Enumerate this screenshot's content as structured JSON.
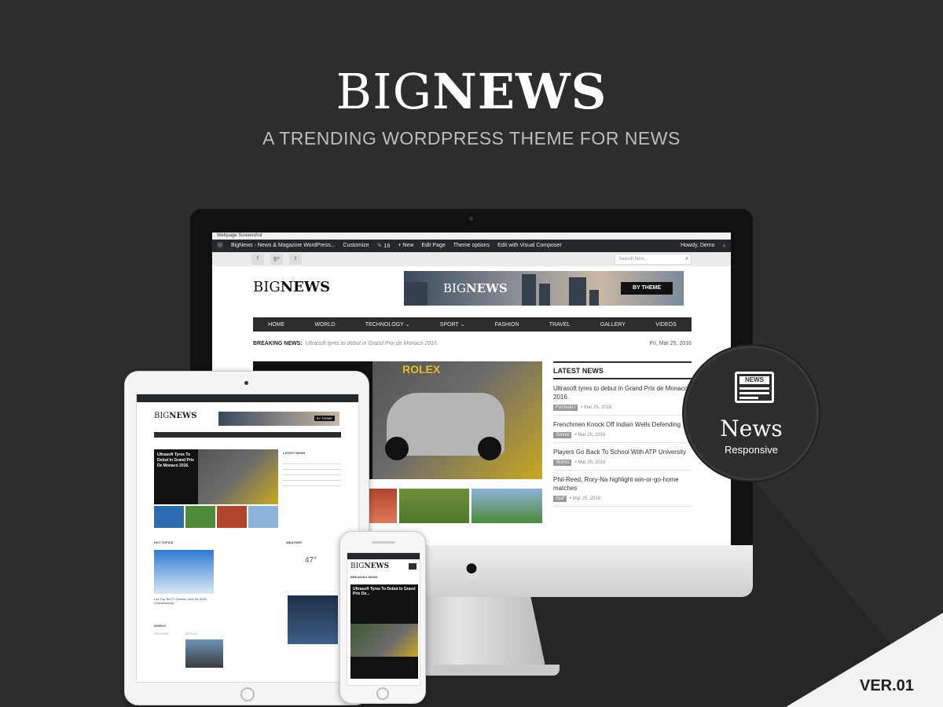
{
  "hero": {
    "title_light": "BIG",
    "title_bold": "NEWS",
    "subtitle": "A TRENDING WORDPRESS THEME FOR NEWS"
  },
  "desktop": {
    "window_title": "Webpage Screenshot",
    "admin_bar": {
      "site": "BigNews - News & Magazine WordPress...",
      "customize": "Customize",
      "comments": "16",
      "new": "New",
      "edit_page": "Edit Page",
      "theme_options": "Theme options",
      "edit_composer": "Edit with Visual Composer",
      "howdy": "Howdy, Demo"
    },
    "social": [
      "f",
      "g+",
      "t"
    ],
    "search_placeholder": "Search here...",
    "logo_light": "BIG",
    "logo_bold": "NEWS",
    "banner": {
      "light": "BIG",
      "bold": "NEWS",
      "button": "BY THEME"
    },
    "nav": [
      "HOME",
      "WORLD",
      "TECHNOLOGY ⌄",
      "SPORT ⌄",
      "FASHION",
      "TRAVEL",
      "GALLERY",
      "VIDEOS"
    ],
    "breaking_label": "BREAKING NEWS:",
    "breaking_text": "Ultrasoft tyres to debut in Grand Prix de Monaco 2016.",
    "date": "Fri, Mar 25, 2016",
    "hero_sign": "ROLEX",
    "latest_heading": "LATEST NEWS",
    "latest": [
      {
        "title": "Ultrasoft tyres to debut in Grand Prix de Monaco 2016.",
        "tag": "Formula I",
        "date": "Mar 25, 2016"
      },
      {
        "title": "Frenchmen Knock Off Indian Wells Defending",
        "tag": "Tennis",
        "date": "Mar 25, 2016"
      },
      {
        "title": "Players Go Back To School With ATP University",
        "tag": "Tennis",
        "date": "Mar 25, 2016"
      },
      {
        "title": "Phil-Reed, Rory-Na highlight win-or-go-home matches",
        "tag": "Golf",
        "date": "Mar 25, 2016"
      }
    ]
  },
  "badge": {
    "icon_text": "NEWS",
    "line1": "News",
    "line2": "Responsive"
  },
  "tablet": {
    "logo_light": "BIG",
    "logo_bold": "NEWS",
    "banner_button": "BY THEME",
    "feature": "Ultrasoft Tyres To Debut In Grand Prix De Monaco 2016.",
    "latest_heading": "LATEST NEWS",
    "hot_topics": "HOT TOPICS",
    "weather": "WEATHER",
    "temp": "47°",
    "world": "WORLD",
    "regions": [
      "REGIONS",
      "AFRICA"
    ],
    "ski_caption": "Las Top Ten F1 Drivers Joes De 2016 Championship"
  },
  "phone": {
    "logo_light": "BIG",
    "logo_bold": "NEWS",
    "breaking": "BREAKING NEWS",
    "feature": "Ultrasoft Tyres To Debut In Grand Prix De..."
  },
  "version": "VER.01",
  "colors": {
    "background": "#2d2d2d",
    "nav": "#2d2d2d",
    "accent_sign": "#e5c117"
  }
}
